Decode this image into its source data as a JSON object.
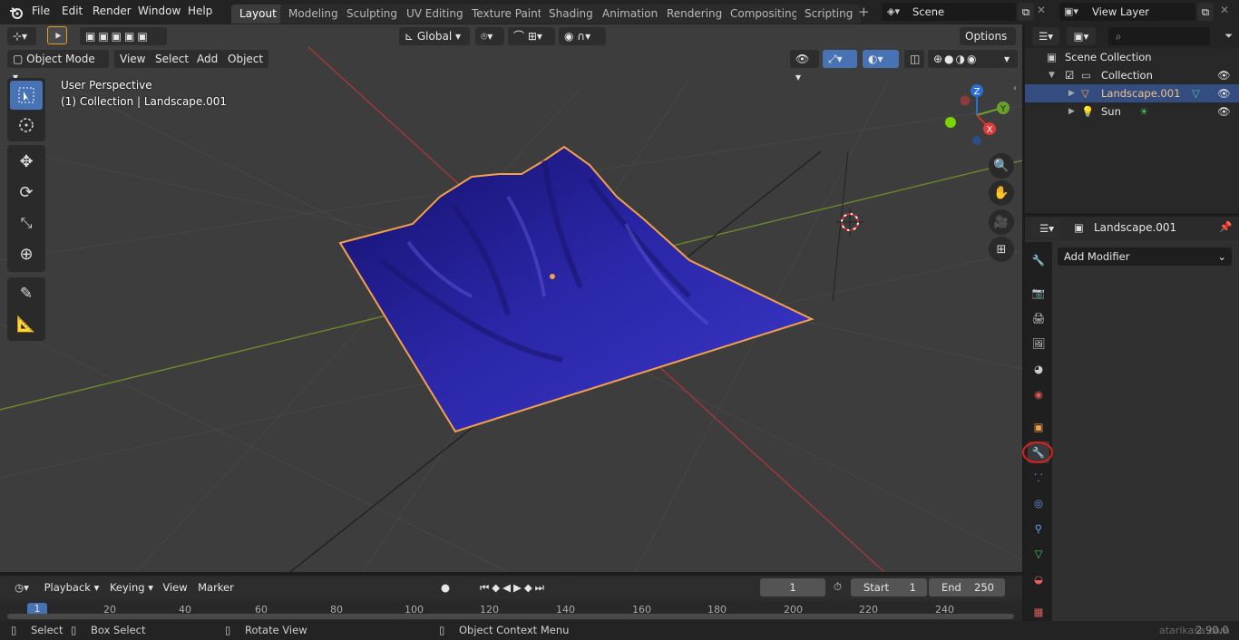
{
  "menu": [
    "File",
    "Edit",
    "Render",
    "Window",
    "Help"
  ],
  "workspaces": [
    "Layout",
    "Modeling",
    "Sculpting",
    "UV Editing",
    "Texture Paint",
    "Shading",
    "Animation",
    "Rendering",
    "Compositing",
    "Scripting"
  ],
  "active_workspace": "Layout",
  "scene_name": "Scene",
  "view_layer": "View Layer",
  "viewport": {
    "transform_orientation": "Global",
    "options_label": "Options",
    "mode": "Object Mode",
    "menus": [
      "View",
      "Select",
      "Add",
      "Object"
    ],
    "perspective_label": "User Perspective",
    "collection_label": "(1) Collection | Landscape.001",
    "gizmo_axes": {
      "x": "X",
      "y": "Y",
      "z": "Z"
    }
  },
  "outliner": {
    "root": "Scene Collection",
    "collection": "Collection",
    "items": [
      {
        "name": "Landscape.001",
        "selected": true
      },
      {
        "name": "Sun",
        "selected": false
      }
    ]
  },
  "properties": {
    "object_name": "Landscape.001",
    "add_modifier_label": "Add Modifier"
  },
  "timeline": {
    "menus": [
      "Playback",
      "Keying",
      "View",
      "Marker"
    ],
    "current_frame": "1",
    "start_label": "Start",
    "start": "1",
    "end_label": "End",
    "end": "250",
    "ruler": [
      "1",
      "20",
      "40",
      "60",
      "80",
      "100",
      "120",
      "140",
      "160",
      "180",
      "200",
      "220",
      "240"
    ]
  },
  "status": {
    "select": "Select",
    "box_select": "Box Select",
    "rotate_view": "Rotate View",
    "context_menu": "Object Context Menu",
    "version": "2.90.0"
  },
  "watermark": "atarikasa.com",
  "colors": {
    "accent": "#4772b3",
    "selection_orange": "#f4a04b",
    "landscape_blue": "#2a24a8",
    "highlight_circle": "#e01e1e"
  }
}
